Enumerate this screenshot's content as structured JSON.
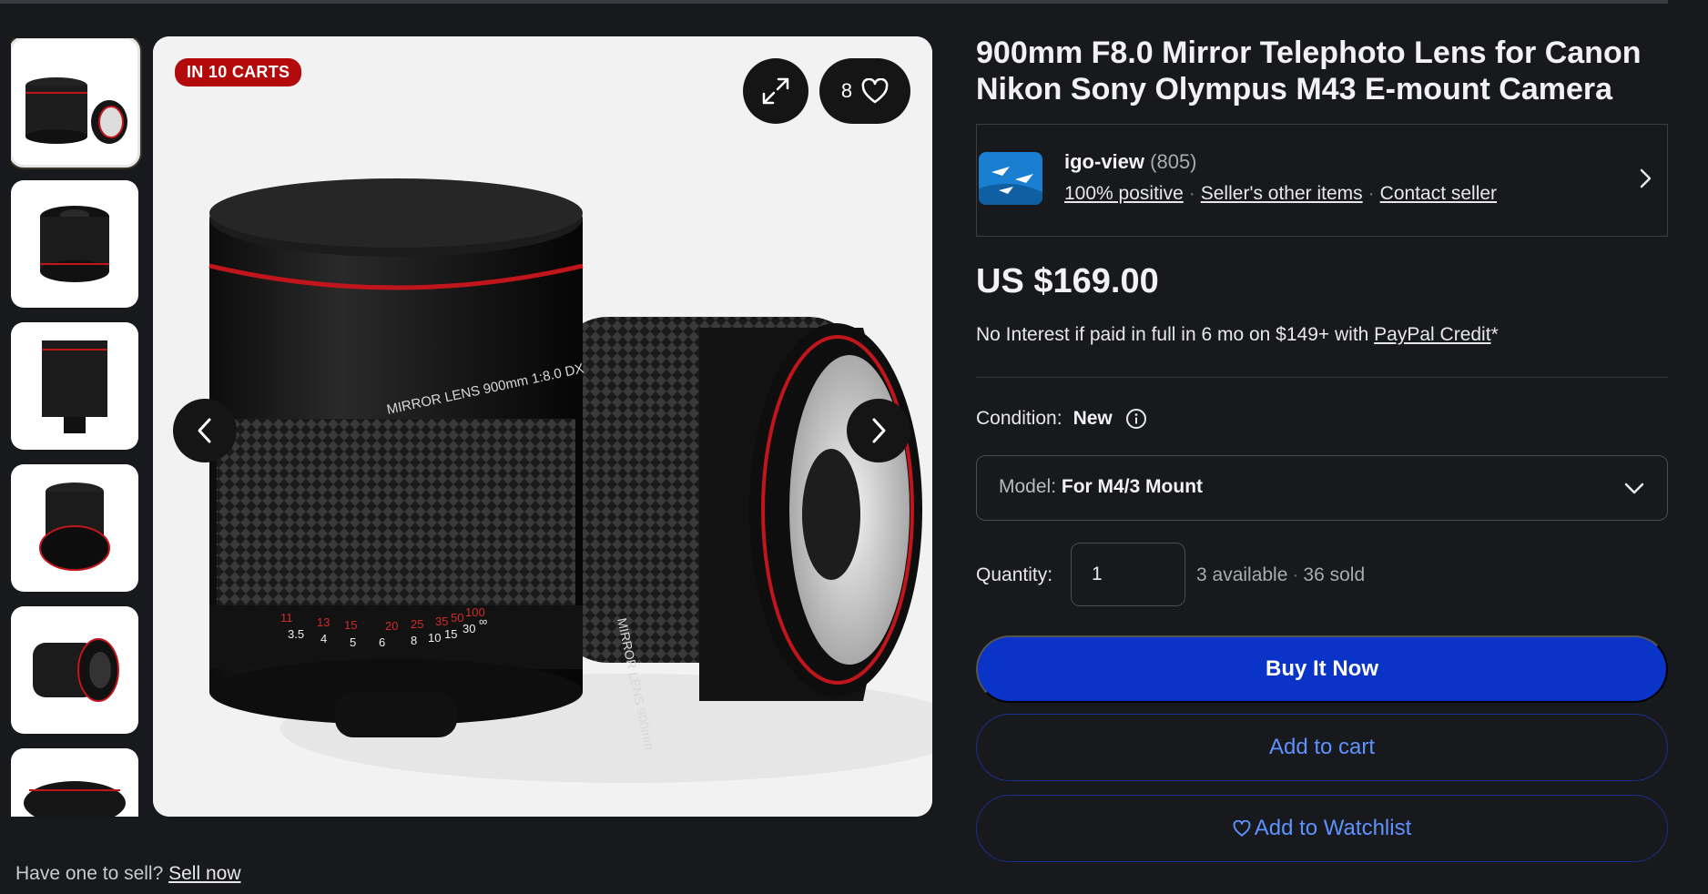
{
  "badge": "IN 10 CARTS",
  "likes_count": "8",
  "title": "900mm F8.0 Mirror Telephoto Lens for Canon Nikon Sony Olympus M43 E-mount Camera",
  "seller": {
    "name": "igo-view",
    "feedback_count": "(805)",
    "positive": "100% positive",
    "other_items": "Seller's other items",
    "contact": "Contact seller"
  },
  "price": "US $169.00",
  "credit": {
    "prefix": "No Interest if paid in full in 6 mo on $149+ with ",
    "link": "PayPal Credit",
    "suffix": "*"
  },
  "condition": {
    "label": "Condition:",
    "value": "New"
  },
  "model": {
    "label": "Model:",
    "value": "For M4/3 Mount"
  },
  "quantity": {
    "label": "Quantity:",
    "value": "1",
    "available": "3 available",
    "sold": "36 sold"
  },
  "buttons": {
    "buy": "Buy It Now",
    "cart": "Add to cart",
    "watch": "Add to Watchlist"
  },
  "sell": {
    "prompt": "Have one to sell?",
    "link": "Sell now"
  },
  "lens_text": {
    "front": "MIRROR LENS 900mm 1:8.0 DX",
    "side": "MIRROR LENS 900mm"
  },
  "scale": {
    "red": [
      "11",
      "13",
      "15",
      "20",
      "25",
      "35",
      "50",
      "100"
    ],
    "white": [
      "3.5",
      "4",
      "5",
      "6",
      "8",
      "10",
      "15",
      "30",
      "∞"
    ]
  },
  "colors": {
    "buy": "#0a33c8",
    "badge": "#b30b0b",
    "link_blue": "#5e92ff"
  },
  "icons": [
    "expand-icon",
    "heart-icon",
    "chevron-left-icon",
    "chevron-right-icon",
    "info-icon",
    "chevron-down-icon"
  ]
}
